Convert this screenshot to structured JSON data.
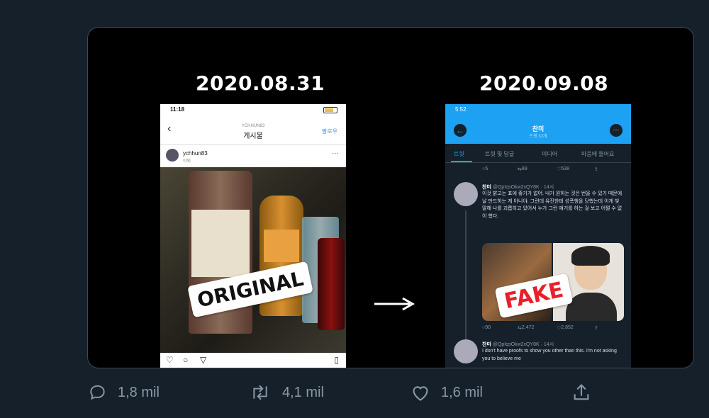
{
  "tweet": {
    "media": {
      "left_date": "2020.08.31",
      "right_date": "2020.09.08",
      "left_sticker": "ORIGINAL",
      "right_sticker": "FAKE"
    },
    "instagram": {
      "time": "11:18",
      "account_small": "YCHHUN83",
      "title": "게시물",
      "follow": "팔로우",
      "username": "ychhun83",
      "subtitle": "야외"
    },
    "twitter": {
      "time": "5:52",
      "profile_name": "찬미",
      "profile_sub": "트윗 32개",
      "tabs": [
        "트윗",
        "트윗 및 답글",
        "미디어",
        "마음에 들어요"
      ],
      "stats_top": [
        "5",
        "89",
        "538"
      ],
      "post1": {
        "name": "찬미",
        "handle": "@QpIqsOkw2xQY8K · 14시",
        "text": "이것 밝고는 표에 좋기가 없어. 내가 원하는 것은 번을 수 있기 때문에 날 만드하는 게 아니야. 그런데 유진한테 성폭행을 당했는데 이게 빛 말해 나를 괴롭히고 있어서 누가 그런 얘기를 하는 걸 보고 어쩔 수 없이 했다."
      },
      "stats_mid": [
        "90",
        "2,472",
        "2,852"
      ],
      "post2": {
        "name": "찬미",
        "handle": "@QpIqsOkw2xQY8K · 14시",
        "text": "I don't have proofs to show you other than this. I'm not asking you to believe me"
      }
    },
    "actions": {
      "reply_count": "1,8 mil",
      "retweet_count": "4,1 mil",
      "like_count": "1,6 mil"
    }
  },
  "colors": {
    "background": "#15202b",
    "twitter_blue": "#1da1f2",
    "action_gray": "#8899a6"
  }
}
